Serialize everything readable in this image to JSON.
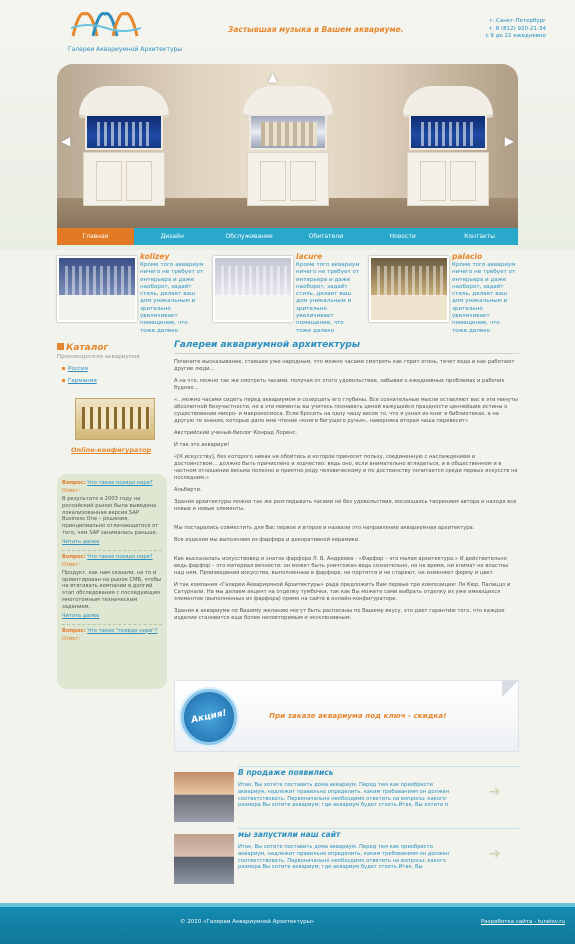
{
  "header": {
    "logo_text": "Галереи Аквариумной Архитектуры",
    "slogan": "Застывшая музыка в Вашем аквариуме.",
    "city": "г. Санкт-Петербург",
    "phone": "т. 8 (812) 920-21-34",
    "hours": "с 9 до 22 ежедневно"
  },
  "nav": [
    {
      "label": "Главная",
      "active": true
    },
    {
      "label": "Дизайн"
    },
    {
      "label": "Обслуживание"
    },
    {
      "label": "Обитатели"
    },
    {
      "label": "Новости"
    },
    {
      "label": "Контакты"
    }
  ],
  "features": [
    {
      "title": "kolizey",
      "text": "Кроме того аквариум ничего не требует от интерьера и даже наоборот, задаёт стиль, делает ваш дом уникальным и зрительно увеличивает помещение, что тоже далеко"
    },
    {
      "title": "lacure",
      "text": "Кроме того аквариум ничего не требует от интерьера и даже наоборот, задаёт стиль, делает ваш дом уникальным и зрительно увеличивает помещение, что тоже далеко"
    },
    {
      "title": "palacio",
      "text": "Кроме того аквариум ничего не требует от интерьера и даже наоборот, задаёт стиль, делает ваш дом уникальным и зрительно увеличивает помещение, что тоже далеко"
    }
  ],
  "catalog": {
    "title": "Каталог",
    "subtitle": "Производители аквариумов",
    "items": [
      "Россия",
      "Германия"
    ],
    "config_link": "Online-конфигуратор"
  },
  "faq": [
    {
      "q_label": "Вопрос:",
      "q": "Что такое псевдо норе?",
      "a_label": "Ответ:",
      "a": "В результате в 2003 году на российский рынок была выведена локализованная версия SAP Business One – решения, принципиально отличающегося от того, чем SAP занималась раньше.",
      "more": "Читать далее"
    },
    {
      "q_label": "Вопрос:",
      "q": "Что такое псевдо норе?",
      "a_label": "Ответ:",
      "a": "Продукт, как нам сказали, на то и ориентирован на рынок СМБ, чтобы не втягивать компании в долгий этап обследования с последующим многотомным техническим заданием.",
      "more": "Читать далее"
    },
    {
      "q_label": "Вопрос:",
      "q": "Что такое \"псевдо норе\"?",
      "a_label": "Ответ:",
      "a": "",
      "more": ""
    }
  ],
  "main": {
    "title": "Галереи аквариумной архитектуры",
    "paragraphs": [
      "Почините высказывание, ставшее уже народным, что можно часами смотреть как горит огонь, течет вода и как работают другие люди...",
      "А на что, можно так же смотреть часами, получая от этого удовольствие, забывая о ежедневных проблемах и рабочих буднях...",
      "«...можно часами сидеть перед аквариумом и созерцать его глубины. Все сознательные мысли оставляют вас в эти минуты абсолютной безучастности, но в эти моменты вы учитесь познавать ценой кажущейся праздности ценнейшие истины о существовании микро- и макрокосмоса. Если бросить на одну чашу весов то, что я узнал из книг в библиотеках, а на другую те знания, которые дало мне чтение «книги бегущего ручья», наверняка вторая чаша перевесит»",
      "Австрийский ученый-биолог Конрад Лоренс.",
      "И так это аквариум!",
      "«[К искусству], без которого никак не обойтись и которое приносит пользу, соединенную с наслаждением и достоинством... должно быть причислено и зодчество: ведь оно, если внимательно вглядеться, и в общественном и в частном отношении весьма полезно и приятно роду человеческому и по достоинству почитается среди первых искусств не последним.»",
      "Альберти.",
      "Здания архитектуры можно так же разглядывать часами не без удовольствия, восхищаясь творением автора и находя все новые и новые элементы.",
      "Мы постарались совместить для Вас первое и второе и назвали это направление аквариумная архитектура.",
      "Все изделия мы выполняем из фарфора и декоративной керамики.",
      "Как высказалась искусствовед и знаток фарфора Л. В. Андреева - «Фарфор – это малая архитектура.» И действительно ведь фарфор – это материал вечности: он может быть уничтожен ведь сознательно, но не время, ни климат не властны над ним. Произведения искусства, выполненные в фарфоре, не портятся и не стареют, не изменяют форму и цвет.",
      "И так компания «Галереи Аквариумной Архитектуры» рада предложить Вам первые три композиции: Ля Кюр, Палаццо и Сатурнали. На мы делаем акцент на отделку тумбочки, так как Вы можете сами выбрать отделку из уже имеющихся элементов (выполненных из фарфора) прямо на сайте в онлайн-конфигураторе.",
      "Здания в аквариуме по Вашему желанию могут быть расписаны по Вашему вкусу, это дает гарантию того, что каждое изделие становится еще более неповторимым и эксклюзивным."
    ]
  },
  "promo": {
    "badge": "Акция!",
    "text": "При заказе аквариума под ключ - скидка!"
  },
  "news": [
    {
      "title": "В продаже появились",
      "text": "Итак, Вы хотите поставить дома аквариум. Перед тем как приобрести аквариум, надлежит правильно определить, каким требованиям он должен соответствовать. Первоначально необходимо ответить на вопросы: какого размера Вы хотите аквариум; где аквариум будет стоять.Итак, Вы хотите п"
    },
    {
      "title": "мы запустили наш сайт",
      "text": "Итак, Вы хотите поставить дома аквариум. Перед тем как приобрести аквариум, надлежит правильно определить, каким требованиям он должен соответствовать. Первоначально необходимо ответить на вопросы: какого размера Вы хотите аквариум; где аквариум будет стоять.Итак, Вы"
    }
  ],
  "footer": {
    "copyright": "© 2010 «Галереи Аквариумной Архитектуры»",
    "developer": "Разработка сайта - turatov.ru"
  },
  "colors": {
    "accent": "#e6872d",
    "brand": "#2c8fbf",
    "nav": "#2aa8cb",
    "footer": "#158ab0"
  }
}
